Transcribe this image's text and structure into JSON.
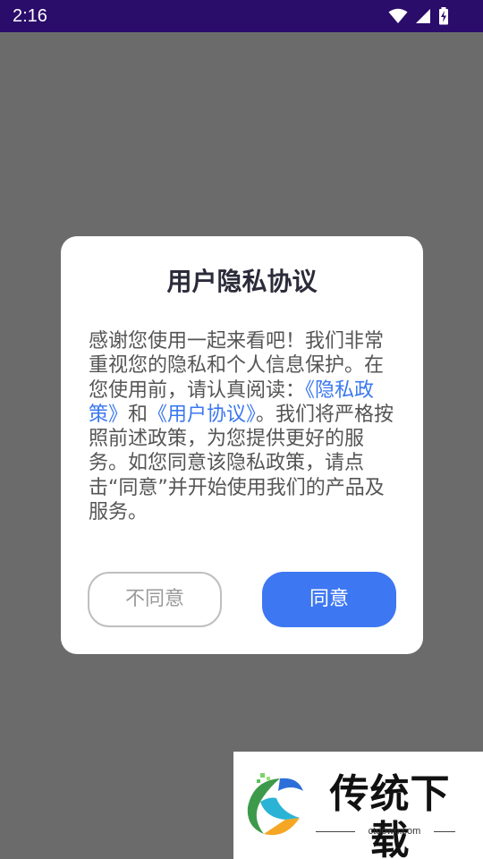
{
  "status_bar": {
    "time": "2:16"
  },
  "dialog": {
    "title": "用户隐私协议",
    "body": {
      "text_before": "感谢您使用一起来看吧！我们非常重视您的隐私和个人信息保护。在您使用前，请认真阅读：",
      "privacy_link": "《隐私政策》",
      "connector": "和",
      "user_agreement_link": "《用户协议》",
      "text_after": "。我们将严格按照前述政策，为您提供更好的服务。如您同意该隐私政策，请点击“同意”并开始使用我们的产品及服务。"
    },
    "disagree_label": "不同意",
    "agree_label": "同意"
  },
  "watermark": {
    "brand": "传统下载",
    "url": "ctdown.com"
  },
  "colors": {
    "status_bar": "#2a0c6b",
    "overlay": "#6b6b6b",
    "accent": "#3d77f2",
    "link": "#3b78f0"
  }
}
